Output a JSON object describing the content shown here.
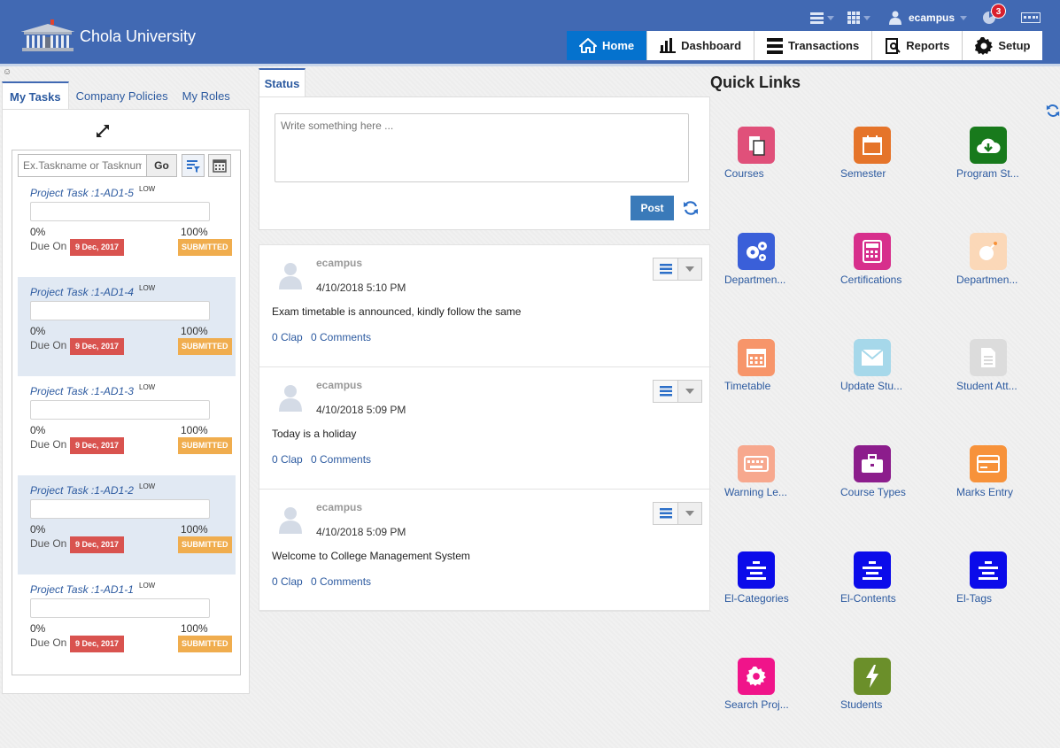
{
  "app": {
    "brand": "Chola University",
    "user": "ecampus",
    "notification_count": "3"
  },
  "nav": {
    "tabs": [
      {
        "label": "Home",
        "icon": "home-icon",
        "active": true
      },
      {
        "label": "Dashboard",
        "icon": "bar-chart-icon"
      },
      {
        "label": "Transactions",
        "icon": "stack-icon"
      },
      {
        "label": "Reports",
        "icon": "report-icon"
      },
      {
        "label": "Setup",
        "icon": "gear-icon"
      }
    ]
  },
  "left": {
    "tabs": [
      "My Tasks",
      "Company Policies",
      "My Roles"
    ],
    "search_placeholder": "Ex.Taskname or Tasknumber",
    "go_label": "Go",
    "tasks": [
      {
        "title": "Project Task :1-AD1-5",
        "priority": "LOW",
        "progress_min": "0%",
        "progress_max": "100%",
        "due_label": "Due On",
        "due_date": "9 Dec, 2017",
        "status": "SUBMITTED"
      },
      {
        "title": "Project Task :1-AD1-4",
        "priority": "LOW",
        "progress_min": "0%",
        "progress_max": "100%",
        "due_label": "Due On",
        "due_date": "9 Dec, 2017",
        "status": "SUBMITTED"
      },
      {
        "title": "Project Task :1-AD1-3",
        "priority": "LOW",
        "progress_min": "0%",
        "progress_max": "100%",
        "due_label": "Due On",
        "due_date": "9 Dec, 2017",
        "status": "SUBMITTED"
      },
      {
        "title": "Project Task :1-AD1-2",
        "priority": "LOW",
        "progress_min": "0%",
        "progress_max": "100%",
        "due_label": "Due On",
        "due_date": "9 Dec, 2017",
        "status": "SUBMITTED"
      },
      {
        "title": "Project Task :1-AD1-1",
        "priority": "LOW",
        "progress_min": "0%",
        "progress_max": "100%",
        "due_label": "Due On",
        "due_date": "9 Dec, 2017",
        "status": "SUBMITTED"
      }
    ]
  },
  "status": {
    "tab_label": "Status",
    "placeholder": "Write something here ...",
    "post_label": "Post"
  },
  "feed": {
    "posts": [
      {
        "user": "ecampus",
        "time": "4/10/2018 5:10 PM",
        "text": "Exam timetable is announced, kindly follow the same",
        "clap": "0 Clap",
        "comments": "0 Comments"
      },
      {
        "user": "ecampus",
        "time": "4/10/2018 5:09 PM",
        "text": "Today is a holiday",
        "clap": "0 Clap",
        "comments": "0 Comments"
      },
      {
        "user": "ecampus",
        "time": "4/10/2018 5:09 PM",
        "text": "Welcome to College Management System",
        "clap": "0 Clap",
        "comments": "0 Comments"
      }
    ]
  },
  "quick_links": {
    "title": "Quick Links",
    "items": [
      {
        "label": "Courses",
        "color": "#e0507a",
        "icon": "document-icon"
      },
      {
        "label": "Semester",
        "color": "#e5742a",
        "icon": "calendar-icon"
      },
      {
        "label": "Program St...",
        "color": "#187a1c",
        "icon": "cloud-download-icon"
      },
      {
        "label": "Departmen...",
        "color": "#3a5fd9",
        "icon": "gears-icon"
      },
      {
        "label": "Certifications",
        "color": "#d72f8c",
        "icon": "calculator-icon"
      },
      {
        "label": "Departmen...",
        "color": "#fbd8b8",
        "icon": "bomb-icon"
      },
      {
        "label": "Timetable",
        "color": "#f7956a",
        "icon": "calendar-grid-icon"
      },
      {
        "label": "Update Stu...",
        "color": "#a6d8ea",
        "icon": "envelope-icon"
      },
      {
        "label": "Student Att...",
        "color": "#dcdcdc",
        "icon": "file-icon"
      },
      {
        "label": "Warning Le...",
        "color": "#f7a88e",
        "icon": "keyboard-icon"
      },
      {
        "label": "Course Types",
        "color": "#8c1d8c",
        "icon": "briefcase-icon"
      },
      {
        "label": "Marks Entry",
        "color": "#f7923a",
        "icon": "card-icon"
      },
      {
        "label": "El-Categories",
        "color": "#0b0bea",
        "icon": "stack-lines-icon"
      },
      {
        "label": "El-Contents",
        "color": "#0b0bea",
        "icon": "stack-lines-icon"
      },
      {
        "label": "El-Tags",
        "color": "#0b0bea",
        "icon": "stack-lines-icon"
      },
      {
        "label": "Search Proj...",
        "color": "#f0148a",
        "icon": "gear-icon"
      },
      {
        "label": "Students",
        "color": "#6b8f2a",
        "icon": "bolt-icon"
      }
    ]
  }
}
